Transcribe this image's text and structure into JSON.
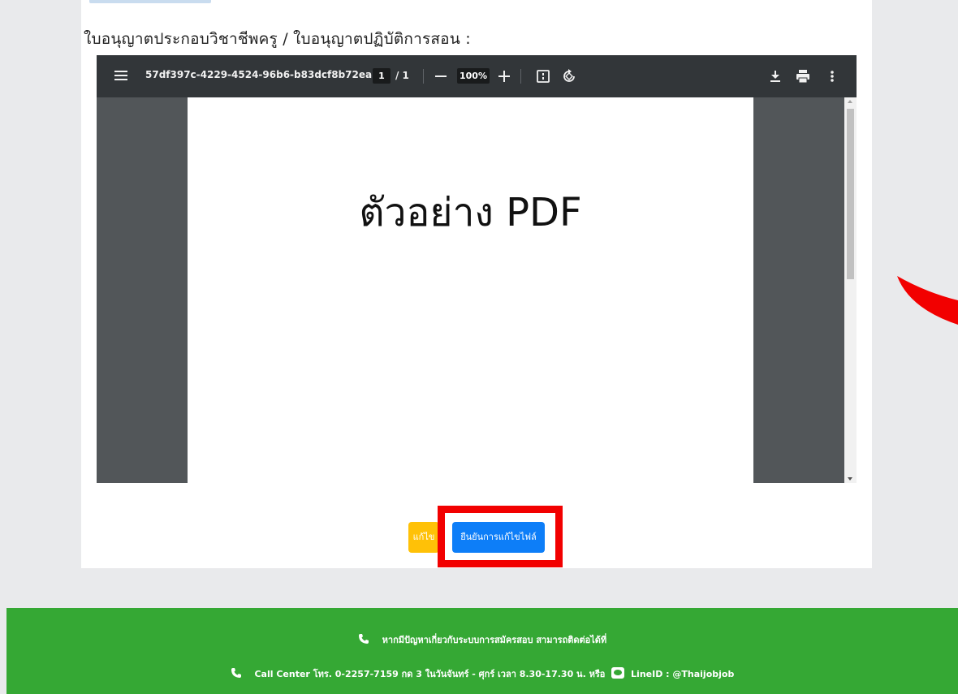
{
  "form": {
    "document_label": "ใบอนุญาตประกอบวิชาชีพครู / ใบอนุญาตปฏิบัติการสอน :"
  },
  "pdf_viewer": {
    "filename": "57df397c-4229-4524-96b6-b83dcf8b72ea",
    "current_page": "1",
    "page_total": "/ 1",
    "zoom": "100%",
    "zoom_out_icon": "minus-icon",
    "zoom_in_icon": "plus-icon",
    "page_text": "ตัวอย่าง PDF"
  },
  "actions": {
    "edit_label": "แก้ไข",
    "confirm_label": "ยืนยันการแก้ไขไฟล์",
    "highlight_color": "#f20000",
    "confirm_color": "#0d7ef8",
    "edit_color": "#ffc107"
  },
  "footer": {
    "help_text": "หากมีปัญหาเกี่ยวกับระบบการสมัครสอบ สามารถติดต่อได้ที่",
    "call_center_text": "Call Center โทร. 0-2257-7159 กด 3 ในวันจันทร์ - ศุกร์ เวลา 8.30-17.30 น. หรือ",
    "line_text": "LineID : @Thaijobjob",
    "bg_color": "#35a834"
  }
}
